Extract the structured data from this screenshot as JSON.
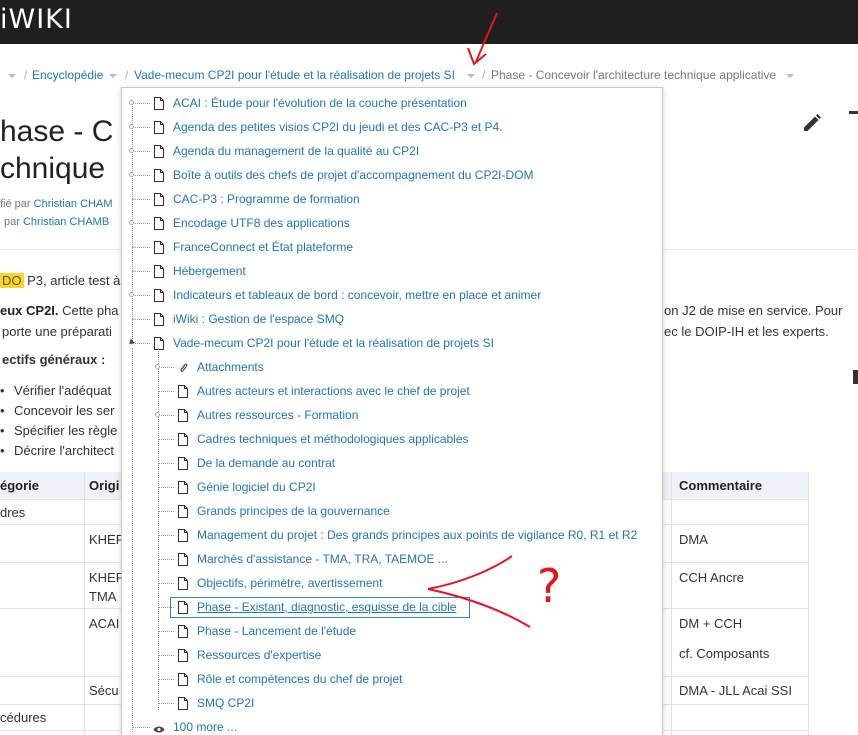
{
  "app": {
    "logo": "iWIKI"
  },
  "breadcrumb": {
    "items": [
      {
        "label": "Encyclopédie"
      },
      {
        "label": "Vade-mecum CP2I pour l'étude et la réalisation de projets SI"
      },
      {
        "label": "Phase - Concevoir l'architecture technique applicative"
      }
    ]
  },
  "page": {
    "title_line1": "hase - C",
    "title_line2": "chnique",
    "meta_modified_prefix": "fié par",
    "meta_modified_user": "Christian CHAM",
    "meta_created_prefix": "par",
    "meta_created_user": "Christian CHAMB",
    "todo_badge": "DO",
    "todo_text": "P3, article test à",
    "para1_bold": "eux CP2I.",
    "para1_text": "Cette pha",
    "para1_right": "on J2 de mise en service. Pour",
    "para2_text": "porte une préparati",
    "para2_right": "ec le DOIP-IH et les experts.",
    "objectives": "ectifs généraux :",
    "bullets": [
      "Vérifier l'adéquat",
      "Concevoir les ser",
      "Spécifier les règle",
      "Décrire l'architect"
    ]
  },
  "table": {
    "headers": [
      "égorie",
      "Origi",
      "Commentaire"
    ],
    "col1": [
      "dres",
      "",
      "",
      "",
      "",
      "cédures"
    ],
    "col2": [
      "",
      "KHEF",
      "KHEF",
      "TMA",
      "ACAI",
      "Sécu"
    ],
    "col3": [
      "",
      "DMA",
      "CCH Ancre",
      "DM + CCH",
      "cf. Composants",
      "DMA - JLL Acai SSI"
    ]
  },
  "dropdown": {
    "items_level1": [
      "ACAI : Étude pour l'évolution de la couche présentation",
      "Agenda des petites visios CP2I du jeudi et des CAC-P3 et P4.",
      "Agenda du management de la qualité au CP2I",
      "Boîte à outils des chefs de projet d'accompagnement du CP2I-DOM",
      "CAC-P3 : Programme de formation",
      "Encodage UTF8 des applications",
      "FranceConnect et État plateforme",
      "Hébergement",
      "Indicateurs et tableaux de bord : concevoir, mettre en place et animer",
      "iWiki : Gestion de l'espace SMQ",
      "Vade-mecum CP2I pour l'étude et la réalisation de projets SI"
    ],
    "items_level2": [
      "Attachments",
      "Autres acteurs et interactions avec le chef de projet",
      "Autres ressources - Formation",
      "Cadres techniques et méthodologiques applicables",
      "De la demande au contrat",
      "Génie logiciel du CP2I",
      "Grands principes de la gouvernance",
      "Management du projet : Des grands principes aux points de vigilance R0, R1 et R2",
      "Marchés d'assistance - TMA, TRA, TAEMOE ...",
      "Objectifs, périmètre, avertissement",
      "Phase - Existant, diagnostic, esquisse de la cible",
      "Phase - Lancement de l'étude",
      "Ressources d'expertise",
      "Rôle et compétences du chef de projet",
      "SMQ CP2I"
    ],
    "more": "100 more ...",
    "selected_index": 10
  },
  "annotation": {
    "color": "#e8141c",
    "mark": "?"
  },
  "colors": {
    "link": "#2176b5",
    "topbar": "#1f1f1f",
    "todo": "#f4d531",
    "table_head": "#eef1f8"
  }
}
